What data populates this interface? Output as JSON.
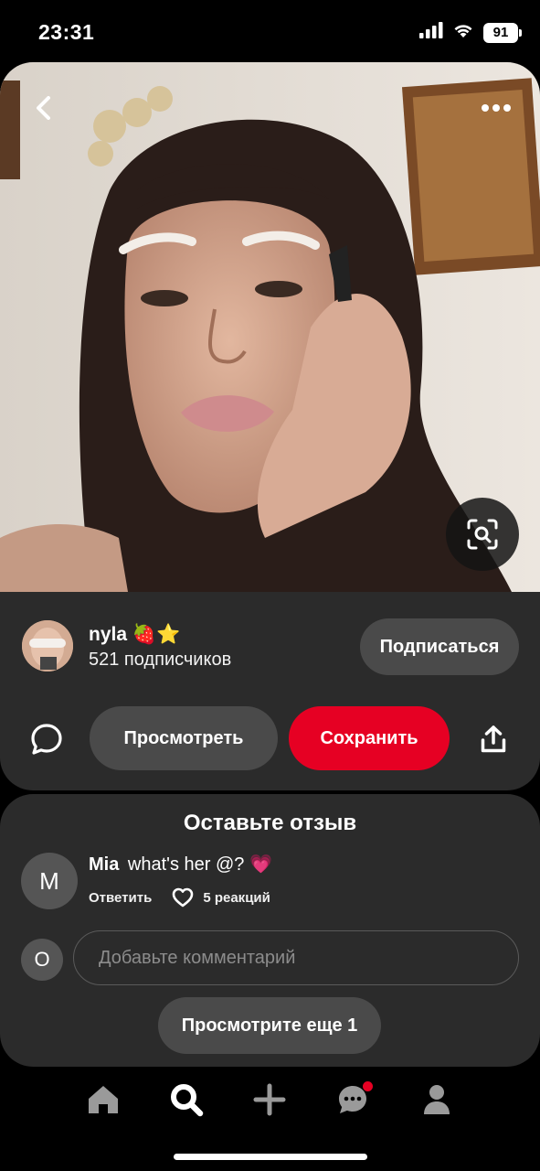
{
  "status_bar": {
    "time": "23:31",
    "battery": "91"
  },
  "pin": {
    "image_alt": "selfie photo",
    "back_icon": "chevron-left-icon",
    "more_icon": "ellipsis-icon",
    "lens_icon": "visual-search-icon"
  },
  "creator": {
    "name": "nyla 🍓⭐",
    "followers": "521 подписчиков",
    "follow_label": "Подписаться"
  },
  "actions": {
    "view_label": "Просмотреть",
    "save_label": "Сохранить",
    "comment_icon": "comment-bubble-icon",
    "share_icon": "share-icon"
  },
  "comments": {
    "title": "Оставьте отзыв",
    "items": [
      {
        "avatar_letter": "M",
        "author": "Mia",
        "text": "what's her @? 💗",
        "reply_label": "Ответить",
        "reactions": "5 реакций"
      }
    ],
    "my_avatar_letter": "O",
    "input_placeholder": "Добавьте комментарий",
    "more_label": "Просмотрите еще 1"
  },
  "nav": {
    "items": [
      "home",
      "search",
      "create",
      "messages",
      "profile"
    ]
  },
  "colors": {
    "accent": "#e60023",
    "card": "#2b2b2b",
    "button": "#4a4a4a"
  }
}
